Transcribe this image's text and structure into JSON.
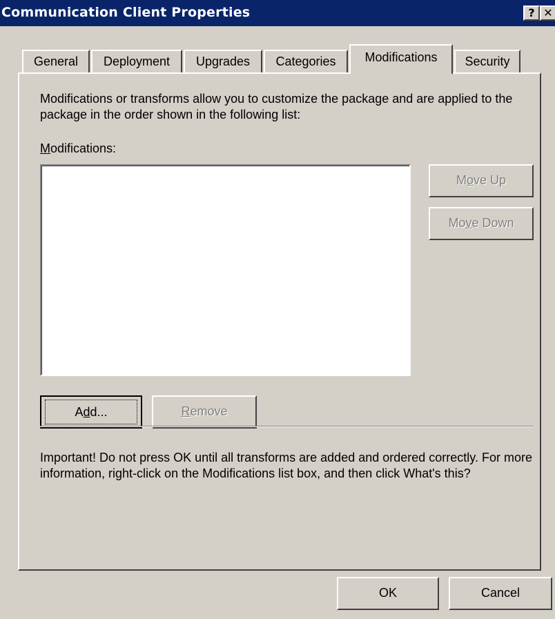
{
  "window": {
    "title": "Communication Client Properties",
    "help_glyph": "?",
    "close_glyph": "✕"
  },
  "tabs": [
    {
      "label": "General"
    },
    {
      "label": "Deployment"
    },
    {
      "label": "Upgrades"
    },
    {
      "label": "Categories"
    },
    {
      "label": "Modifications",
      "active": true
    },
    {
      "label": "Security"
    }
  ],
  "modifications": {
    "description": "Modifications or transforms allow you to customize the package and are applied to the package in the order shown in the following list:",
    "list_label_accel": "M",
    "list_label_rest": "odifications:",
    "list_items": [],
    "move_up": {
      "pre": "M",
      "accel": "o",
      "post": "ve Up",
      "enabled": false
    },
    "move_down": {
      "pre": "Mo",
      "accel": "v",
      "post": "e Down",
      "enabled": false
    },
    "add": {
      "pre": "A",
      "accel": "d",
      "post": "d...",
      "enabled": true
    },
    "remove": {
      "pre": "",
      "accel": "R",
      "post": "emove",
      "enabled": false
    },
    "important": "Important! Do not press OK until all transforms are added and ordered correctly.  For more information, right-click on the Modifications list box, and then click What's this?"
  },
  "footer": {
    "ok": "OK",
    "cancel": "Cancel"
  },
  "colors": {
    "titlebar": "#0a246a",
    "face": "#d4d0c8",
    "disabled_text": "#808080"
  }
}
